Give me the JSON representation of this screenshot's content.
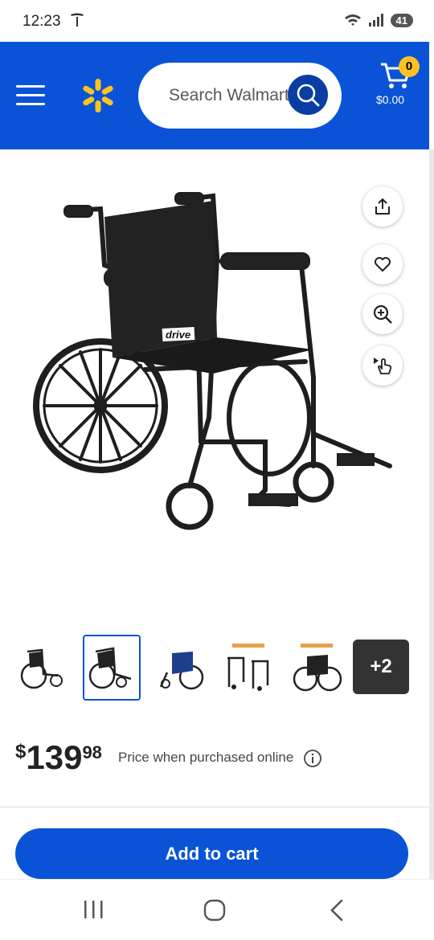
{
  "status": {
    "time": "12:23",
    "battery": "41"
  },
  "header": {
    "search_placeholder": "Search Walmart",
    "cart_count": "0",
    "cart_total": "$0.00"
  },
  "colors": {
    "brand_blue": "#0a53d6",
    "spark_yellow": "#ffc220",
    "search_button": "#0a3ea3"
  },
  "product": {
    "brand_on_image": "drive",
    "thumbnails": [
      {
        "name": "wheelchair-side"
      },
      {
        "name": "wheelchair-front",
        "selected": true
      },
      {
        "name": "wheelchair-blue"
      },
      {
        "name": "wheelchair-folded"
      },
      {
        "name": "wheelchair-rear"
      }
    ],
    "more_thumbnails": "+2"
  },
  "price": {
    "currency": "$",
    "dollars": "139",
    "cents": "98",
    "note": "Price when purchased online"
  },
  "actions": {
    "add_to_cart": "Add to cart"
  },
  "icons": [
    "menu-icon",
    "walmart-spark-icon",
    "search-icon",
    "cart-icon",
    "share-icon",
    "heart-icon",
    "zoom-icon",
    "view-3d-icon",
    "info-icon",
    "recents-icon",
    "home-icon",
    "back-icon"
  ]
}
